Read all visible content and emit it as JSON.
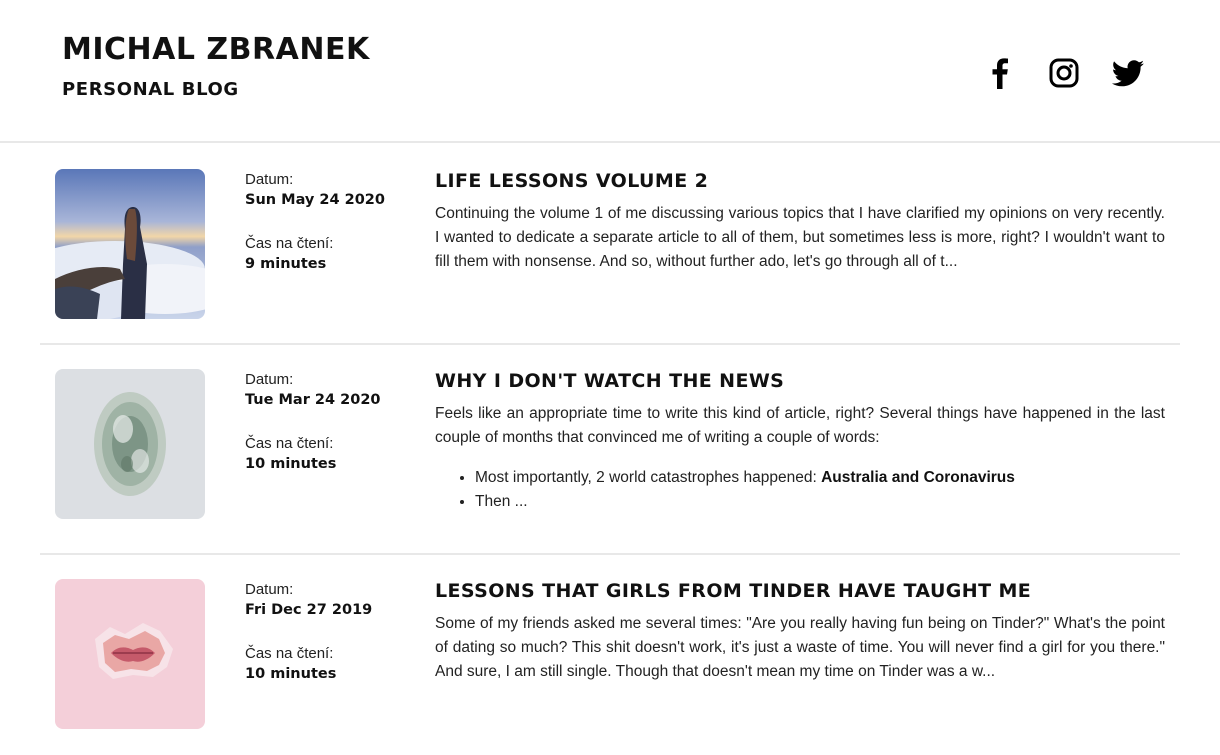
{
  "header": {
    "title": "MICHAL ZBRANEK",
    "subtitle": "PERSONAL BLOG",
    "social": [
      {
        "icon": "facebook-icon"
      },
      {
        "icon": "instagram-icon"
      },
      {
        "icon": "twitter-icon"
      }
    ]
  },
  "labels": {
    "date": "Datum:",
    "reading_time": "Čas na čtení:"
  },
  "posts": [
    {
      "date": "Sun May 24 2020",
      "reading_time": "9 minutes",
      "title": "LIFE LESSONS VOLUME 2",
      "excerpt": "Continuing the volume 1 of me discussing various topics that I have clarified my opinions on very recently. I wanted to dedicate a separate article to all of them, but sometimes less is more, right? I wouldn't want to fill them with nonsense. And so, without further ado, let's go through all of t..."
    },
    {
      "date": "Tue Mar 24 2020",
      "reading_time": "10 minutes",
      "title": "WHY I DON'T WATCH THE NEWS",
      "excerpt": "Feels like an appropriate time to write this kind of article, right? Several things have happened in the last couple of months that convinced me of writing a couple of words:",
      "bullets": [
        {
          "text": "Most importantly, 2 world catastrophes happened: ",
          "bold": "Australia and Coronavirus"
        },
        {
          "text": "Then ...",
          "bold": ""
        }
      ]
    },
    {
      "date": "Fri Dec 27 2019",
      "reading_time": "10 minutes",
      "title": "LESSONS THAT GIRLS FROM TINDER HAVE TAUGHT ME",
      "excerpt": "Some of my friends asked me several times: \"Are you really having fun being on Tinder?\" What's the point of dating so much? This shit doesn't work, it's just a waste of time. You will never find a girl for you there.\" And sure, I am still single. Though that doesn't mean my time on Tinder was a w..."
    }
  ]
}
